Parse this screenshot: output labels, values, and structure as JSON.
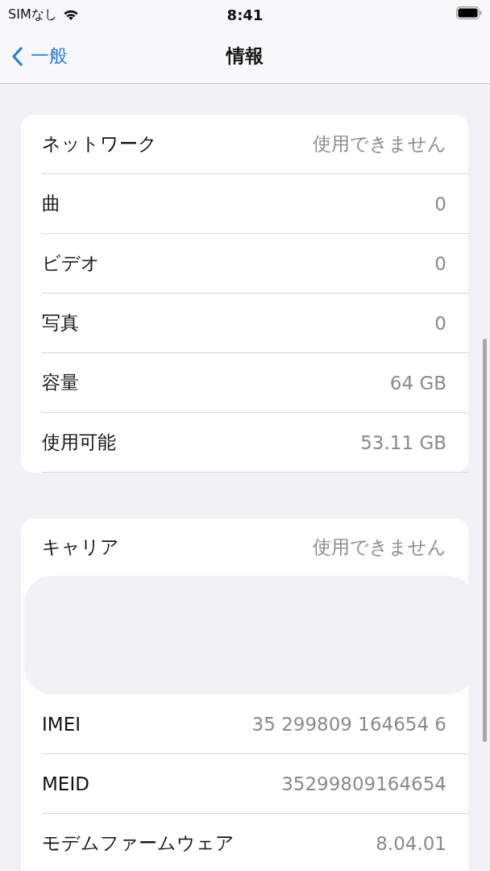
{
  "status_bar": {
    "carrier": "SIMなし",
    "time": "8:41"
  },
  "nav": {
    "back": "一般",
    "title": "情報"
  },
  "sections": [
    {
      "rows": [
        {
          "label": "ネットワーク",
          "value": "使用できません"
        },
        {
          "label": "曲",
          "value": "0"
        },
        {
          "label": "ビデオ",
          "value": "0"
        },
        {
          "label": "写真",
          "value": "0"
        },
        {
          "label": "容量",
          "value": "64 GB"
        },
        {
          "label": "使用可能",
          "value": "53.11 GB"
        }
      ]
    },
    {
      "rows": [
        {
          "label": "キャリア",
          "value": "使用できません"
        },
        {
          "kind": "blank"
        },
        {
          "label": "IMEI",
          "value": "35 299809 164654 6"
        },
        {
          "label": "MEID",
          "value": "35299809164654"
        },
        {
          "label": "モデムファームウェア",
          "value": "8.04.01"
        },
        {
          "kind": "cut"
        }
      ]
    }
  ]
}
